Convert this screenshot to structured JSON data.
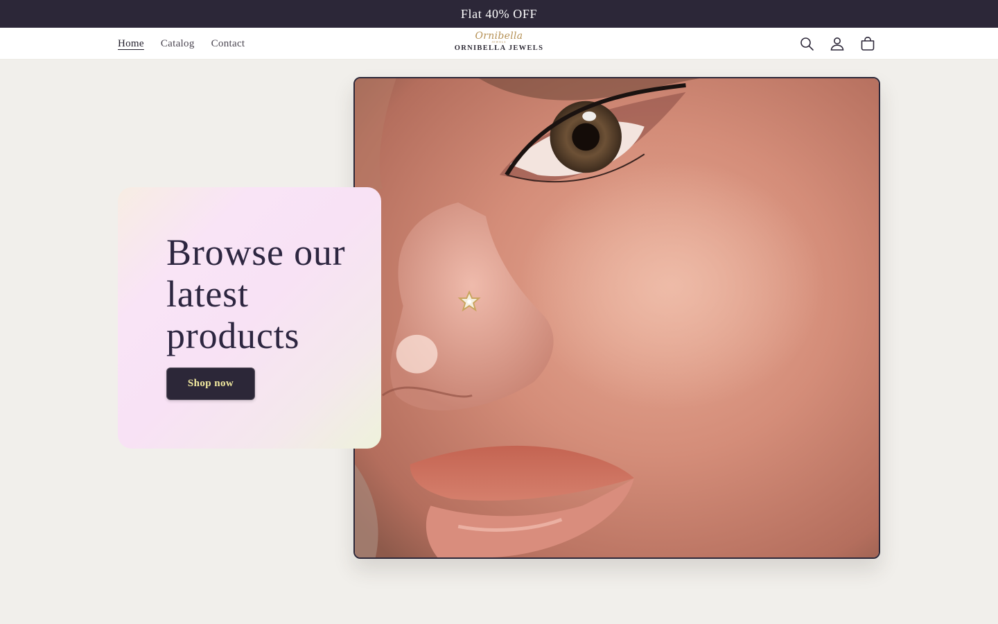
{
  "announcement": {
    "text": "Flat 40% OFF"
  },
  "header": {
    "nav": [
      {
        "label": "Home",
        "active": true
      },
      {
        "label": "Catalog",
        "active": false
      },
      {
        "label": "Contact",
        "active": false
      }
    ],
    "logo": {
      "script": "Ornibella",
      "small": "JEWELS",
      "text": "ORNIBELLA JEWELS"
    },
    "icons": [
      "search-icon",
      "account-icon",
      "cart-icon"
    ]
  },
  "hero": {
    "heading": "Browse our latest products",
    "button_label": "Shop now",
    "image": "close-up portrait with star nose stud"
  },
  "colors": {
    "announcement_bg": "#2c2738",
    "page_bg": "#f1efeb",
    "button_bg": "#2c2738",
    "button_text": "#f3eba0",
    "logo_gold": "#b59054"
  }
}
